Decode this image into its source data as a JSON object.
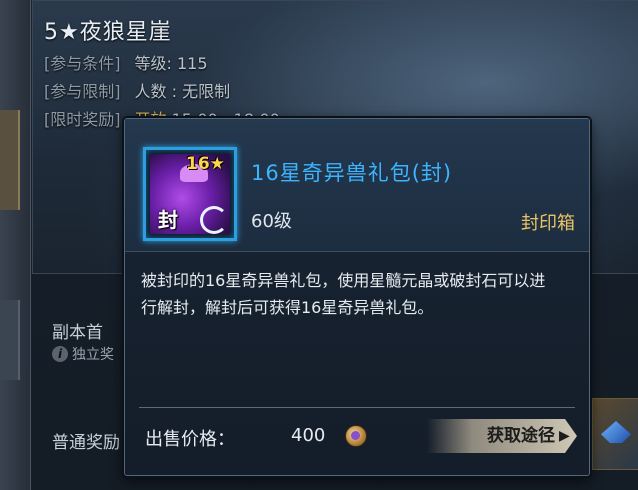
{
  "background": {
    "dungeon_title": "5★夜狼星崖",
    "rows": [
      {
        "key": "[参与条件]",
        "value": "等级: 115"
      },
      {
        "key": "[参与限制]",
        "value": "人数 : 无限制"
      },
      {
        "key": "[限时奖励]",
        "value_highlight": "开放",
        "value": "15:00 - 18:00"
      }
    ],
    "first_clear_label": "副本首",
    "independent_hint": "独立奖",
    "normal_reward_label": "普通奖励"
  },
  "tooltip": {
    "star_level": "16★",
    "seal_char": "封",
    "item_name": "16星奇异兽礼包(封)",
    "item_level": "60级",
    "item_type": "封印箱",
    "description": "被封印的16星奇异兽礼包，使用星髓元晶或破封石可以进行解封，解封后可获得16星奇异兽礼包。",
    "price_label": "出售价格：",
    "price_value": "400",
    "acquire_button": "获取途径"
  },
  "icons": {
    "coin": "coin-icon",
    "hint": "info-icon",
    "arrow": "chevron-right-icon"
  },
  "colors": {
    "item_name": "#3db4ff",
    "item_type": "#e8c366",
    "frame_border": "#2d9fe0"
  }
}
